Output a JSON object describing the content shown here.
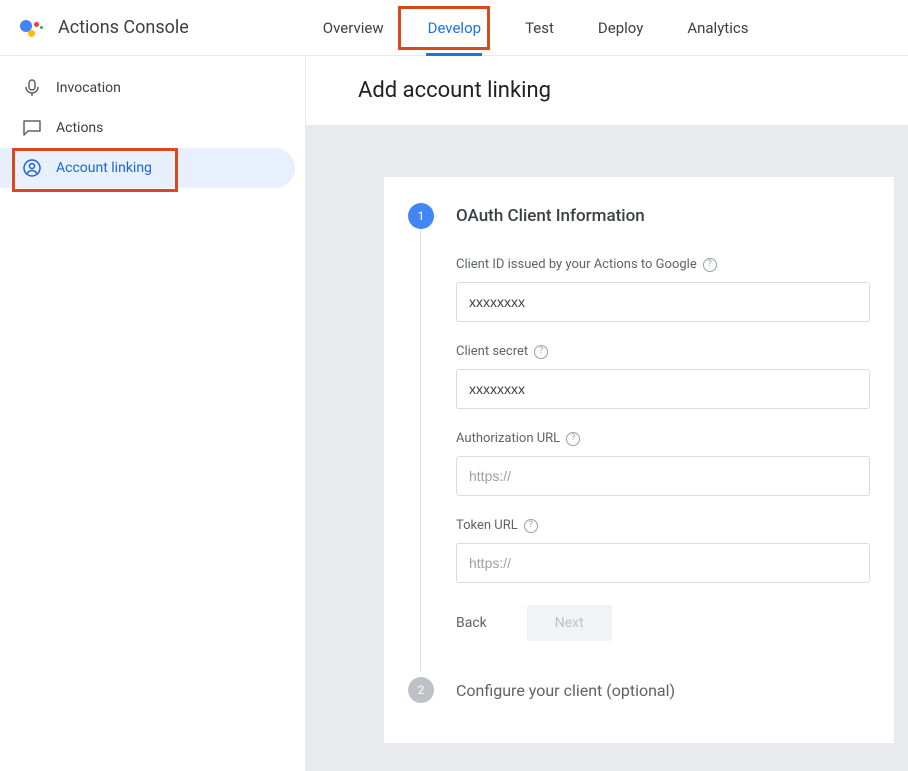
{
  "header": {
    "app_title": "Actions Console",
    "tabs": {
      "overview": "Overview",
      "develop": "Develop",
      "test": "Test",
      "deploy": "Deploy",
      "analytics": "Analytics"
    }
  },
  "sidebar": {
    "invocation": "Invocation",
    "actions": "Actions",
    "account_linking": "Account linking"
  },
  "main": {
    "title": "Add account linking",
    "step1": {
      "num": "1",
      "title": "OAuth Client Information",
      "client_id_label": "Client ID issued by your Actions to Google",
      "client_id_value": "xxxxxxxx",
      "client_secret_label": "Client secret",
      "client_secret_value": "xxxxxxxx",
      "auth_url_label": "Authorization URL",
      "auth_url_placeholder": "https://",
      "token_url_label": "Token URL",
      "token_url_placeholder": "https://",
      "back": "Back",
      "next": "Next"
    },
    "step2": {
      "num": "2",
      "title": "Configure your client (optional)"
    }
  }
}
